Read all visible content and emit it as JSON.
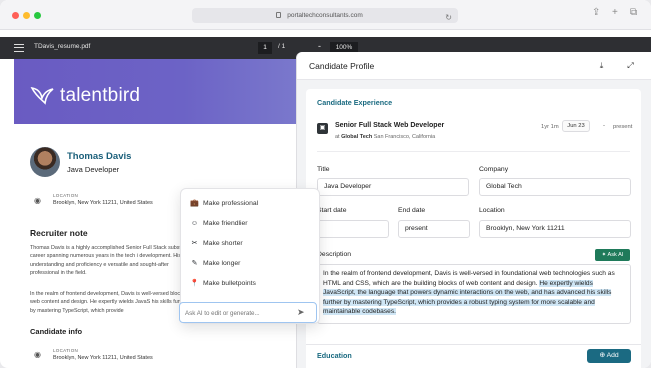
{
  "browser": {
    "url": "portaltechconsultants.com",
    "colors": {
      "close": "#ff5f57",
      "minimize": "#febc2e",
      "maximize": "#28c840"
    }
  },
  "pdf_toolbar": {
    "filename": "TDavis_resume.pdf",
    "page_current": "1",
    "page_total": "/ 1",
    "zoom": "100%",
    "zoom_minus": "-"
  },
  "resume": {
    "brand": "talentbird",
    "name": "Thomas Davis",
    "role": "Java Developer",
    "location_label": "LOCATION",
    "location_value": "Brooklyn, New York 11211, United States",
    "recruiter_note_title": "Recruiter note",
    "note_para1": "Thomas Davis is a highly accomplished Senior Full Stack substantial career spanning numerous years in the tech i development. His deep understanding and proficiency e versatile and sought-after professional in the field.",
    "note_para2": "In the realm of frontend development, Davis is well-versed blocks of web content and design. He expertly wields JavaS his skills further by mastering TypeScript, which provide",
    "candidate_info_title": "Candidate info",
    "candidate_location_label": "LOCATION",
    "candidate_location_value": "Brooklyn, New York 11211, United States"
  },
  "ai_menu": {
    "items": [
      {
        "label": "Make professional",
        "icon": "briefcase-icon"
      },
      {
        "label": "Make friendlier",
        "icon": "smile-icon"
      },
      {
        "label": "Make shorter",
        "icon": "scissors-icon"
      },
      {
        "label": "Make longer",
        "icon": "pencil-icon"
      },
      {
        "label": "Make bulletpoints",
        "icon": "pin-icon"
      }
    ],
    "input_placeholder": "Ask AI to edit or generate..."
  },
  "profile_panel": {
    "title": "Candidate Profile",
    "experience_title": "Candidate Experience",
    "job": {
      "title": "Senior Full Stack Web Developer",
      "at": "at",
      "company": "Global Tech",
      "location": "San Francisco, California",
      "duration": "1yr 1m",
      "start": "Jun 23",
      "dash": "-",
      "end": "present"
    },
    "form": {
      "title_label": "Title",
      "title_value": "Java Developer",
      "company_label": "Company",
      "company_value": "Global Tech",
      "start_label": "Start date",
      "start_value": "",
      "end_label": "End date",
      "end_value": "present",
      "location_label": "Location",
      "location_value": "Brooklyn, New York 11211",
      "description_label": "Description",
      "ask_ai": "Ask AI",
      "description_plain": "In the realm of frontend development, Davis is well-versed in foundational web technologies such as HTML and CSS, which are the building blocks of web content and design. ",
      "description_highlight": "He expertly wields JavaScript, the language that powers dynamic interactions on the web, and has advanced his skills further by mastering TypeScript, which provides a robust typing system for more scalable and maintainable codebases."
    },
    "education_title": "Education",
    "add_button": "Add"
  }
}
